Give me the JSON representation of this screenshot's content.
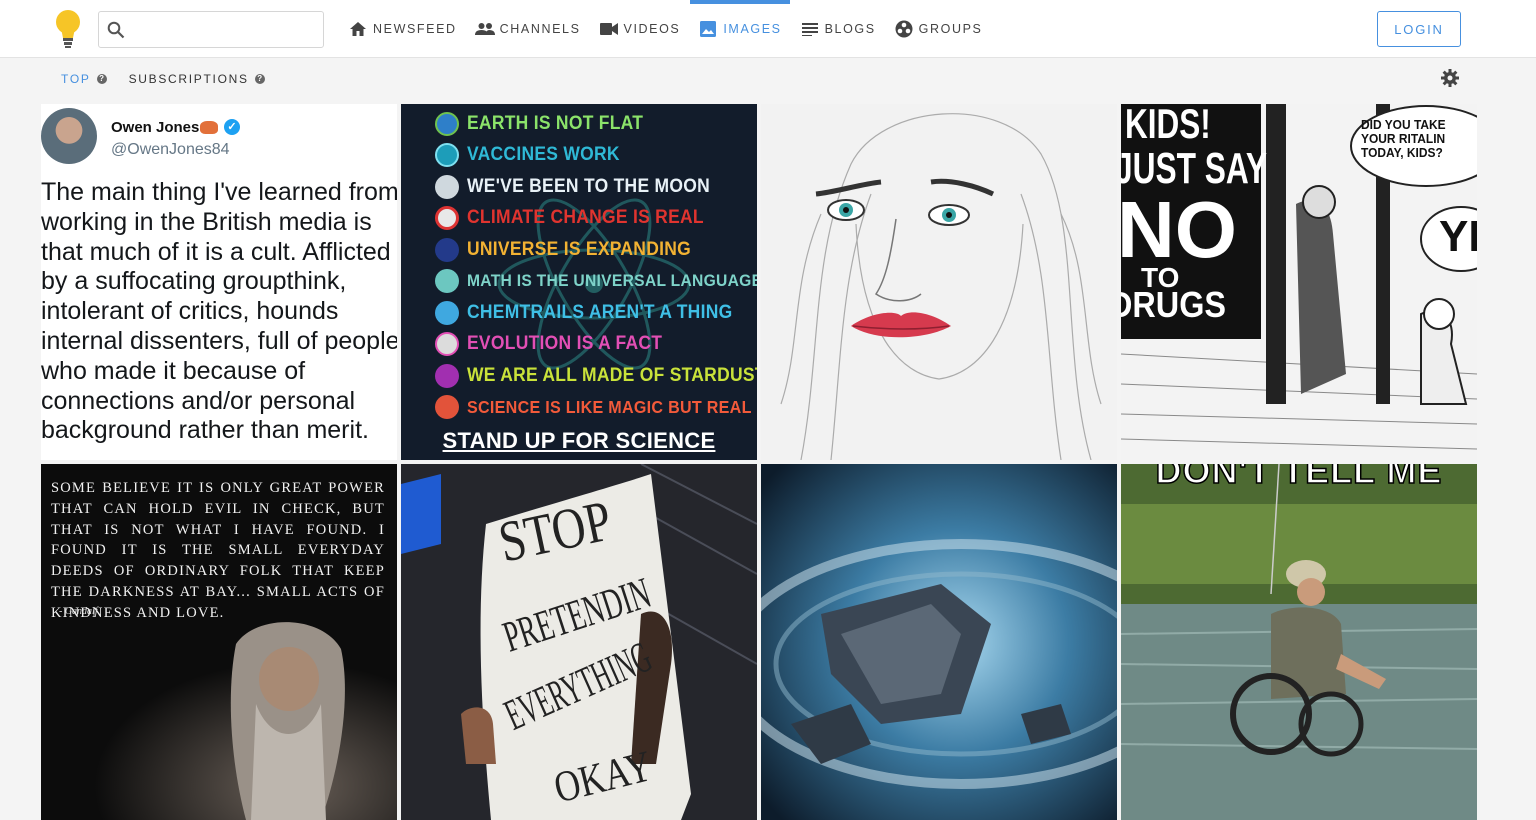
{
  "nav": {
    "search_placeholder": "",
    "items": [
      {
        "label": "NEWSFEED",
        "icon": "home-icon"
      },
      {
        "label": "CHANNELS",
        "icon": "people-icon"
      },
      {
        "label": "VIDEOS",
        "icon": "videocam-icon"
      },
      {
        "label": "IMAGES",
        "icon": "image-icon"
      },
      {
        "label": "BLOGS",
        "icon": "list-icon"
      },
      {
        "label": "GROUPS",
        "icon": "groups-icon"
      }
    ],
    "active": "IMAGES",
    "login_label": "LOGIN"
  },
  "subtabs": [
    {
      "label": "TOP",
      "active": true
    },
    {
      "label": "SUBSCRIPTIONS",
      "active": false
    }
  ],
  "tiles": {
    "tweet": {
      "name": "Owen Jones",
      "handle": "@OwenJones84",
      "text": "The main thing I've learned from working in the British media is that much of it is a cult. Afflicted by a suffocating groupthink, intolerant of critics, hounds internal dissenters, full of people who made it because of connections and/or personal background rather than merit."
    },
    "science": {
      "lines": [
        {
          "text": "EARTH IS NOT FLAT",
          "color": "#8be36a"
        },
        {
          "text": "VACCINES WORK",
          "color": "#2fb9d6"
        },
        {
          "text": "WE'VE BEEN TO THE MOON",
          "color": "#e8f1f7"
        },
        {
          "text": "CLIMATE CHANGE IS REAL",
          "color": "#e0342f"
        },
        {
          "text": "UNIVERSE IS EXPANDING",
          "color": "#f2b233"
        },
        {
          "text": "MATH IS THE UNIVERSAL LANGUAGE",
          "color": "#7ed3c9"
        },
        {
          "text": "CHEMTRAILS AREN'T A THING",
          "color": "#3fbfe6"
        },
        {
          "text": "EVOLUTION IS A FACT",
          "color": "#e24fb5"
        },
        {
          "text": "WE ARE ALL MADE OF STARDUST",
          "color": "#c9e23a"
        },
        {
          "text": "SCIENCE IS LIKE MAGIC BUT REAL",
          "color": "#f25a3a"
        }
      ],
      "footer": "STAND UP FOR SCIENCE"
    },
    "cartoon": {
      "sign_line1": "KIDS!",
      "sign_line2": "JUST SAY",
      "sign_line3": "NO",
      "sign_line4": "TO",
      "sign_line5": "DRUGS",
      "bubble": "DID YOU TAKE YOUR RITALIN TODAY, KIDS?",
      "reply": "YE"
    },
    "gandalf": {
      "quote": "Some believe it is only great power that can hold evil in check, but that is not what I have found. I found it is the small everyday deeds of ordinary folk that keep the darkness at bay... small acts of kindness and love.",
      "author": "- Gandalf"
    },
    "protest": {
      "line1": "STOP",
      "line2": "PRETENDIN",
      "line3": "EVERYTHING",
      "line4": "OKAY"
    },
    "meme": {
      "top": "DON'T TELL ME"
    }
  }
}
